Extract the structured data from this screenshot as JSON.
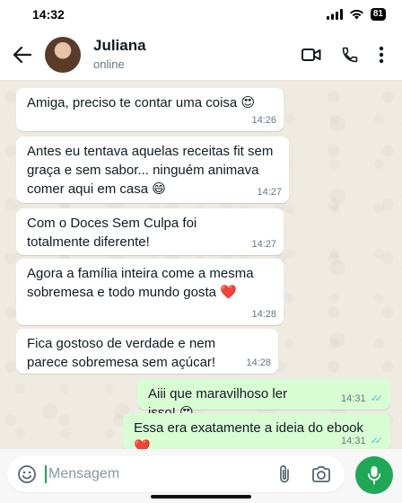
{
  "status_bar": {
    "time": "14:32",
    "battery": "81"
  },
  "header": {
    "contact_name": "Juliana",
    "contact_status": "online"
  },
  "messages": [
    {
      "direction": "in",
      "text": "Amiga, preciso te contar uma coisa 😍",
      "time": "14:26"
    },
    {
      "direction": "in",
      "text": "Antes eu tentava aquelas receitas fit sem graça e sem sabor... ninguém animava comer aqui em casa 😄",
      "time": "14:27"
    },
    {
      "direction": "in",
      "text": "Com o Doces Sem Culpa foi totalmente diferente!",
      "time": "14:27"
    },
    {
      "direction": "in",
      "text": "Agora a família inteira come a mesma sobremesa e todo mundo gosta ❤️",
      "time": "14:28"
    },
    {
      "direction": "in",
      "text": "Fica gostoso de verdade e nem parece sobremesa sem açúcar!",
      "time": "14:28"
    },
    {
      "direction": "out",
      "text": "Aiii que maravilhoso ler isso! 😍",
      "time": "14:31",
      "read": true
    },
    {
      "direction": "out",
      "text": "Essa era exatamente a ideia do ebook ❤️",
      "time": "14:31",
      "read": true
    }
  ],
  "input": {
    "placeholder": "Mensagem",
    "value": ""
  },
  "colors": {
    "accent": "#1fa855",
    "outgoing_bubble": "#d9fdd3",
    "incoming_bubble": "#ffffff",
    "read_ticks": "#53bdeb",
    "chat_background": "#efeae2"
  },
  "icons": {
    "header": [
      "back-arrow-icon",
      "video-call-icon",
      "phone-icon",
      "more-options-icon"
    ],
    "input": [
      "emoji-icon",
      "paperclip-icon",
      "camera-icon",
      "microphone-icon"
    ]
  }
}
